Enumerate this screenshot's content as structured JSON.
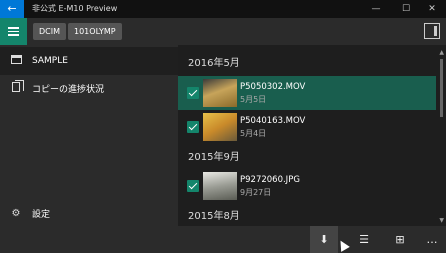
{
  "window": {
    "title": "非公式 E-M10 Preview",
    "back_glyph": "←",
    "minimize_glyph": "—",
    "maximize_glyph": "☐",
    "close_glyph": "✕"
  },
  "header": {
    "breadcrumbs": [
      "DCIM",
      "101OLYMP"
    ]
  },
  "sidebar": {
    "items": [
      {
        "label": "SAMPLE",
        "icon": "folder-icon",
        "selected": true
      },
      {
        "label": "コピーの進捗状況",
        "icon": "copy-icon",
        "selected": false
      }
    ],
    "settings": {
      "label": "設定",
      "icon": "gear-icon",
      "glyph": "⚙"
    }
  },
  "content": {
    "groups": [
      {
        "header": "2016年5月",
        "files": [
          {
            "name": "P5050302.MOV",
            "date": "5月5日",
            "checked": true,
            "active": true,
            "thumb_color": "#c7a45a"
          },
          {
            "name": "P5040163.MOV",
            "date": "5月4日",
            "checked": true,
            "active": false,
            "thumb_color": "#d8b040"
          }
        ]
      },
      {
        "header": "2015年9月",
        "files": [
          {
            "name": "P9272060.JPG",
            "date": "9月27日",
            "checked": true,
            "active": false,
            "thumb_color": "#a9aaa5"
          }
        ]
      },
      {
        "header": "2015年8月",
        "files": []
      }
    ],
    "scroll": {
      "up_glyph": "▲",
      "down_glyph": "▼"
    }
  },
  "bottombar": {
    "buttons": [
      {
        "name": "download-icon",
        "glyph": "⬇"
      },
      {
        "name": "select-list-icon",
        "glyph": "☰"
      },
      {
        "name": "grid-icon",
        "glyph": "⊞"
      },
      {
        "name": "more-icon",
        "glyph": "…"
      }
    ]
  },
  "colors": {
    "accent": "#14856b",
    "active_row": "#195e4e",
    "titlebar_back": "#0078d7"
  }
}
